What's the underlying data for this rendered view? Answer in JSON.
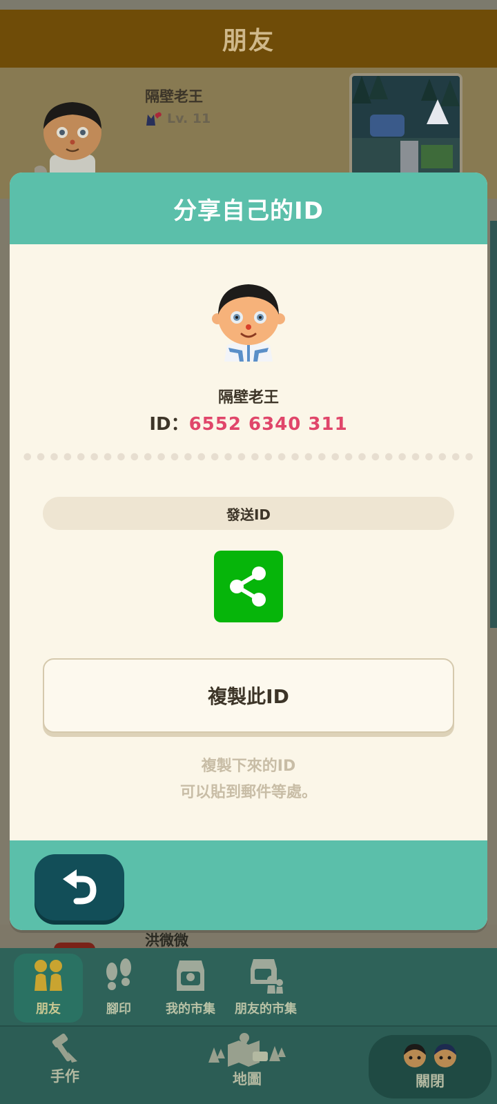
{
  "header": {
    "title": "朋友"
  },
  "friends": [
    {
      "name": "隔壁老王",
      "level": "Lv. 11"
    },
    {
      "name": "洪微微"
    }
  ],
  "modal": {
    "title": "分享自己的ID",
    "player_name": "隔壁老王",
    "id_prefix": "ID：",
    "id_value": "6552 6340 311",
    "send_label": "發送ID",
    "copy_label": "複製此ID",
    "hint_line1": "複製下來的ID",
    "hint_line2": "可以貼到郵件等處。"
  },
  "tabs": [
    {
      "label": "朋友",
      "icon": "friends-icon",
      "active": true
    },
    {
      "label": "腳印",
      "icon": "footprints-icon",
      "active": false
    },
    {
      "label": "我的市集",
      "icon": "my-market-icon",
      "active": false
    },
    {
      "label": "朋友的市集",
      "icon": "friends-market-icon",
      "active": false
    }
  ],
  "main_nav": {
    "craft_label": "手作",
    "map_label": "地圖",
    "close_label": "關閉"
  },
  "colors": {
    "header_brown": "#6f4c08",
    "modal_teal": "#5bbfaa",
    "id_pink": "#e0466a",
    "share_green": "#06b50a",
    "back_button": "#124e58"
  }
}
